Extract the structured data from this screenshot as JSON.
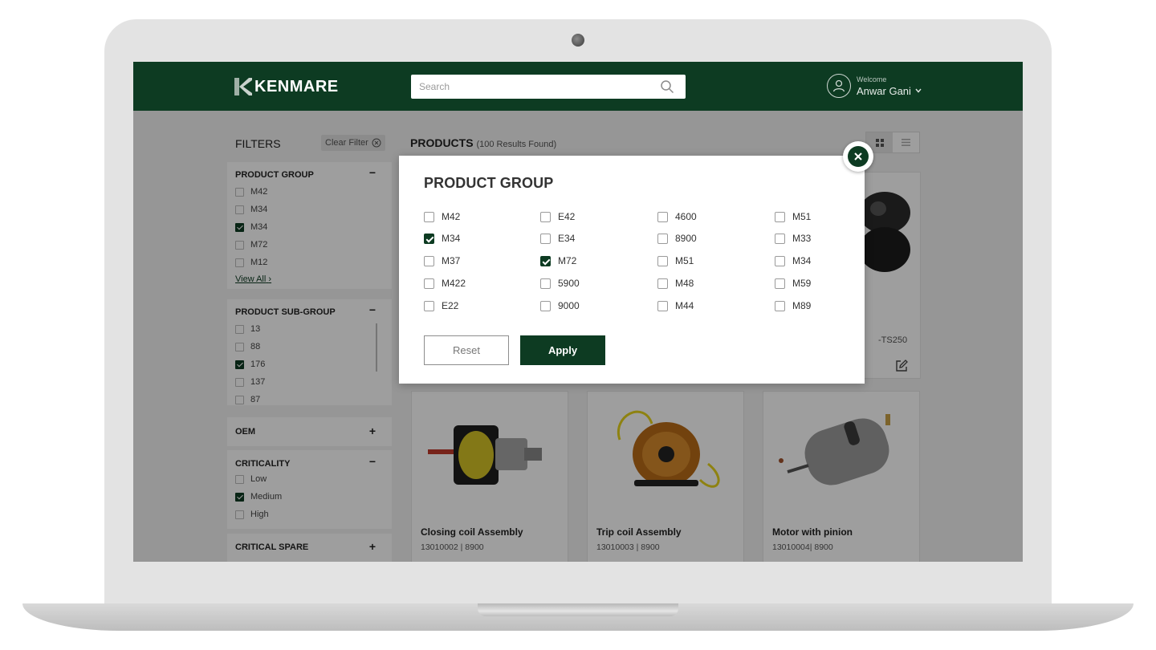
{
  "header": {
    "brand": "KENMARE",
    "search_placeholder": "Search",
    "welcome_label": "Welcome",
    "user_name": "Anwar Gani"
  },
  "filters": {
    "title": "FILTERS",
    "clear_label": "Clear Filter",
    "product_group": {
      "title": "PRODUCT GROUP",
      "toggle": "−",
      "items": [
        {
          "label": "M42",
          "checked": false
        },
        {
          "label": "M34",
          "checked": false
        },
        {
          "label": "M34",
          "checked": true
        },
        {
          "label": "M72",
          "checked": false
        },
        {
          "label": "M12",
          "checked": false
        }
      ],
      "view_all": "View All"
    },
    "product_sub_group": {
      "title": "PRODUCT SUB-GROUP",
      "toggle": "−",
      "items": [
        {
          "label": "13",
          "checked": false
        },
        {
          "label": "88",
          "checked": false
        },
        {
          "label": "176",
          "checked": true
        },
        {
          "label": "137",
          "checked": false
        },
        {
          "label": "87",
          "checked": false
        }
      ]
    },
    "oem": {
      "title": "OEM",
      "toggle": "+"
    },
    "criticality": {
      "title": "CRITICALITY",
      "toggle": "−",
      "items": [
        {
          "label": "Low",
          "checked": false
        },
        {
          "label": "Medium",
          "checked": true
        },
        {
          "label": "High",
          "checked": false
        }
      ]
    },
    "critical_spare": {
      "title": "CRITICAL SPARE",
      "toggle": "+"
    }
  },
  "products": {
    "title": "PRODUCTS",
    "results": "(100 Results Found)",
    "partial_code": "-TS250",
    "cards": [
      {
        "name": "Closing coil Assembly",
        "code": "13010002   |   8900"
      },
      {
        "name": "Trip coil Assembly",
        "code": "13010003   |   8900"
      },
      {
        "name": "Motor with pinion",
        "code": "13010004|   8900"
      }
    ]
  },
  "modal": {
    "title": "PRODUCT GROUP",
    "options": [
      [
        {
          "label": "M42",
          "checked": false
        },
        {
          "label": "E42",
          "checked": false
        },
        {
          "label": "4600",
          "checked": false
        },
        {
          "label": "M51",
          "checked": false
        }
      ],
      [
        {
          "label": "M34",
          "checked": true
        },
        {
          "label": "E34",
          "checked": false
        },
        {
          "label": "8900",
          "checked": false
        },
        {
          "label": "M33",
          "checked": false
        }
      ],
      [
        {
          "label": "M37",
          "checked": false
        },
        {
          "label": "M72",
          "checked": true
        },
        {
          "label": "M51",
          "checked": false
        },
        {
          "label": "M34",
          "checked": false
        }
      ],
      [
        {
          "label": "M422",
          "checked": false
        },
        {
          "label": "5900",
          "checked": false
        },
        {
          "label": "M48",
          "checked": false
        },
        {
          "label": "M59",
          "checked": false
        }
      ],
      [
        {
          "label": "E22",
          "checked": false
        },
        {
          "label": "9000",
          "checked": false
        },
        {
          "label": "M44",
          "checked": false
        },
        {
          "label": "M89",
          "checked": false
        }
      ]
    ],
    "reset_label": "Reset",
    "apply_label": "Apply"
  },
  "colors": {
    "brand_green": "#0d3b22",
    "overlay": "rgba(0,0,0,0.38)"
  }
}
